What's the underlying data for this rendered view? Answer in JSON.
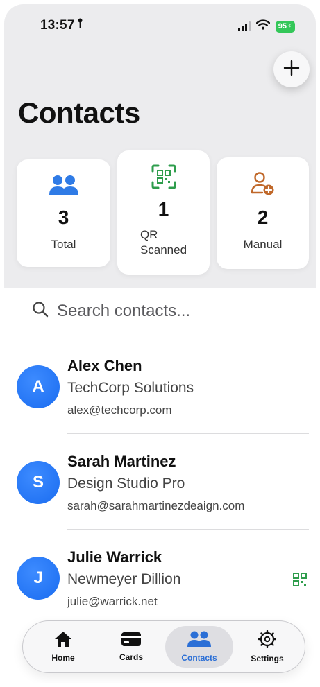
{
  "status_bar": {
    "time": "13:57",
    "battery": "95"
  },
  "header": {
    "title": "Contacts"
  },
  "stats": [
    {
      "value": "3",
      "label": "Total",
      "icon": "people-icon",
      "color": "#2f7be6"
    },
    {
      "value": "1",
      "label": "QR\nScanned",
      "icon": "qr-scan-icon",
      "color": "#2e9d4c"
    },
    {
      "value": "2",
      "label": "Manual",
      "icon": "person-add-icon",
      "color": "#c0682a"
    }
  ],
  "search": {
    "placeholder": "Search contacts..."
  },
  "contacts": [
    {
      "initial": "A",
      "name": "Alex Chen",
      "company": "TechCorp Solutions",
      "email": "alex@techcorp.com",
      "qr_scanned": false
    },
    {
      "initial": "S",
      "name": "Sarah Martinez",
      "company": "Design Studio Pro",
      "email": "sarah@sarahmartinezdeaign.com",
      "qr_scanned": false
    },
    {
      "initial": "J",
      "name": "Julie Warrick",
      "company": "Newmeyer Dillion",
      "email": "julie@warrick.net",
      "qr_scanned": true
    }
  ],
  "tabs": [
    {
      "label": "Home",
      "icon": "house-icon",
      "active": false
    },
    {
      "label": "Cards",
      "icon": "card-icon",
      "active": false
    },
    {
      "label": "Contacts",
      "icon": "people-icon",
      "active": true
    },
    {
      "label": "Settings",
      "icon": "gear-icon",
      "active": false
    }
  ],
  "colors": {
    "accent": "#2b6fd6",
    "avatar": "#1f72f2",
    "qr_green": "#2e9d4c",
    "manual_orange": "#c0682a"
  }
}
